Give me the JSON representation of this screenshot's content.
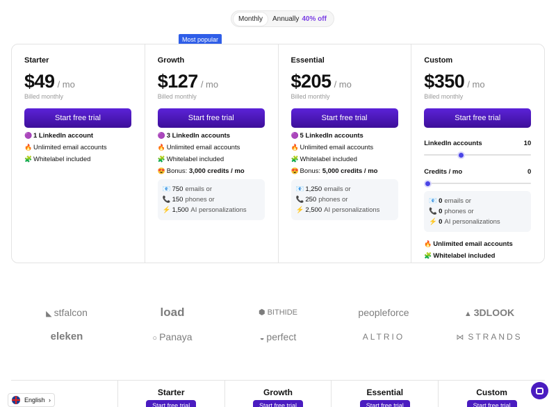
{
  "billing": {
    "monthly_label": "Monthly",
    "annual_label": "Annually",
    "annual_discount": "40% off",
    "selected": "Monthly"
  },
  "badge": "Most popular",
  "plans": [
    {
      "name": "Starter",
      "price": "$49",
      "per": "/ mo",
      "billed": "Billed monthly",
      "cta": "Start free trial",
      "features": [
        {
          "icon": "🟣",
          "text": "1 LinkedIn account"
        },
        {
          "icon": "🔥",
          "text": "Unlimited email accounts"
        },
        {
          "icon": "🧩",
          "text": "Whitelabel included"
        }
      ]
    },
    {
      "name": "Growth",
      "price": "$127",
      "per": "/ mo",
      "billed": "Billed monthly",
      "cta": "Start free trial",
      "features": [
        {
          "icon": "🟣",
          "text": "3 LinkedIn accounts"
        },
        {
          "icon": "🔥",
          "text": "Unlimited email accounts"
        },
        {
          "icon": "🧩",
          "text": "Whitelabel included"
        }
      ],
      "bonus": {
        "icon": "😍",
        "label": "Bonus:",
        "value": "3,000 credits / mo"
      },
      "credits": [
        {
          "icon": "📧",
          "num": "750",
          "text": "emails or"
        },
        {
          "icon": "📞",
          "num": "150",
          "text": "phones or"
        },
        {
          "icon": "⚡",
          "num": "1,500",
          "text": "AI personalizations"
        }
      ]
    },
    {
      "name": "Essential",
      "price": "$205",
      "per": "/ mo",
      "billed": "Billed monthly",
      "cta": "Start free trial",
      "features": [
        {
          "icon": "🟣",
          "text": "5 LinkedIn accounts"
        },
        {
          "icon": "🔥",
          "text": "Unlimited email accounts"
        },
        {
          "icon": "🧩",
          "text": "Whitelabel included"
        }
      ],
      "bonus": {
        "icon": "😍",
        "label": "Bonus:",
        "value": "5,000 credits / mo"
      },
      "credits": [
        {
          "icon": "📧",
          "num": "1,250",
          "text": "emails or"
        },
        {
          "icon": "📞",
          "num": "250",
          "text": "phones or"
        },
        {
          "icon": "⚡",
          "num": "2,500",
          "text": "AI personalizations"
        }
      ]
    },
    {
      "name": "Custom",
      "price": "$350",
      "per": "/ mo",
      "billed": "Billed monthly",
      "cta": "Start free trial",
      "linkedin_label": "LinkedIn accounts",
      "linkedin_value": "10",
      "linkedin_fraction": 0.34,
      "credits_label": "Credits / mo",
      "credits_value": "0",
      "credits_fraction": 0.03,
      "credits": [
        {
          "icon": "📧",
          "num": "0",
          "text": "emails or"
        },
        {
          "icon": "📞",
          "num": "0",
          "text": "phones or"
        },
        {
          "icon": "⚡",
          "num": "0",
          "text": "AI personalizations"
        }
      ],
      "extras": [
        {
          "icon": "🔥",
          "text": "Unlimited email accounts"
        },
        {
          "icon": "🧩",
          "text": "Whitelabel included"
        }
      ]
    }
  ],
  "logos": [
    [
      "stfalcon",
      "load",
      "BITHIDE",
      "peopleforce",
      "3DLOOK"
    ],
    [
      "eleken",
      "Panaya",
      "perfect",
      "ALTRIO",
      "STRANDS"
    ]
  ],
  "compare": {
    "columns": [
      "Starter",
      "Growth",
      "Essential",
      "Custom"
    ],
    "cta": "Start free trial"
  },
  "language": "English"
}
